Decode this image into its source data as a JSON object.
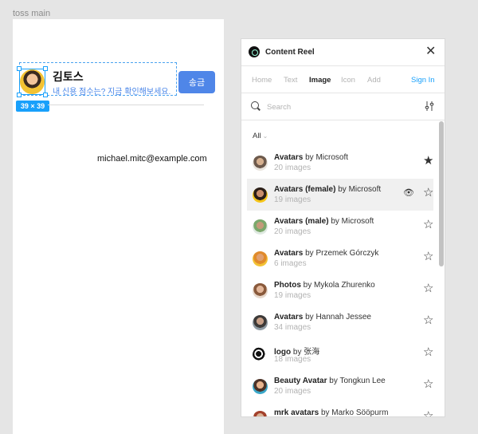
{
  "canvas": {
    "frame_label": "toss main",
    "card": {
      "name": "김토스",
      "subtitle": "내 신용 점수는? 지금 확인해보세요.",
      "send_label": "송금",
      "size_badge": "39 × 39"
    },
    "email": "michael.mitc@example.com"
  },
  "plugin": {
    "title": "Content Reel",
    "tabs": [
      {
        "label": "Home"
      },
      {
        "label": "Text"
      },
      {
        "label": "Image"
      },
      {
        "label": "Icon"
      },
      {
        "label": "Add"
      }
    ],
    "active_tab": "Image",
    "sign_in": "Sign In",
    "search": {
      "placeholder": "Search",
      "value": ""
    },
    "filter": {
      "label": "All"
    },
    "items": [
      {
        "name": "Avatars",
        "by": "by Microsoft",
        "count": "20 images",
        "starred": true
      },
      {
        "name": "Avatars (female)",
        "by": "by Microsoft",
        "count": "19 images",
        "starred": false
      },
      {
        "name": "Avatars (male)",
        "by": "by Microsoft",
        "count": "20 images",
        "starred": false
      },
      {
        "name": "Avatars",
        "by": "by Przemek Górczyk",
        "count": "6 images",
        "starred": false
      },
      {
        "name": "Photos",
        "by": "by Mykola Zhurenko",
        "count": "19 images",
        "starred": false
      },
      {
        "name": "Avatars",
        "by": "by Hannah Jessee",
        "count": "34 images",
        "starred": false
      },
      {
        "name": "logo",
        "by": "by 张海",
        "count": "18 images",
        "starred": false
      },
      {
        "name": "Beauty Avatar",
        "by": "by Tongkun Lee",
        "count": "20 images",
        "starred": false
      },
      {
        "name": "mrk avatars",
        "by": "by Marko Sööpurm",
        "count": "",
        "starred": false
      }
    ],
    "icons": {
      "logo": "content-reel-logo",
      "close": "close-icon",
      "search": "search-icon",
      "filter": "sliders-icon",
      "star": "star-icon",
      "eye": "eye-icon"
    },
    "colors": {
      "accent": "#18a0fb",
      "primary_button": "#4f86e8"
    }
  }
}
